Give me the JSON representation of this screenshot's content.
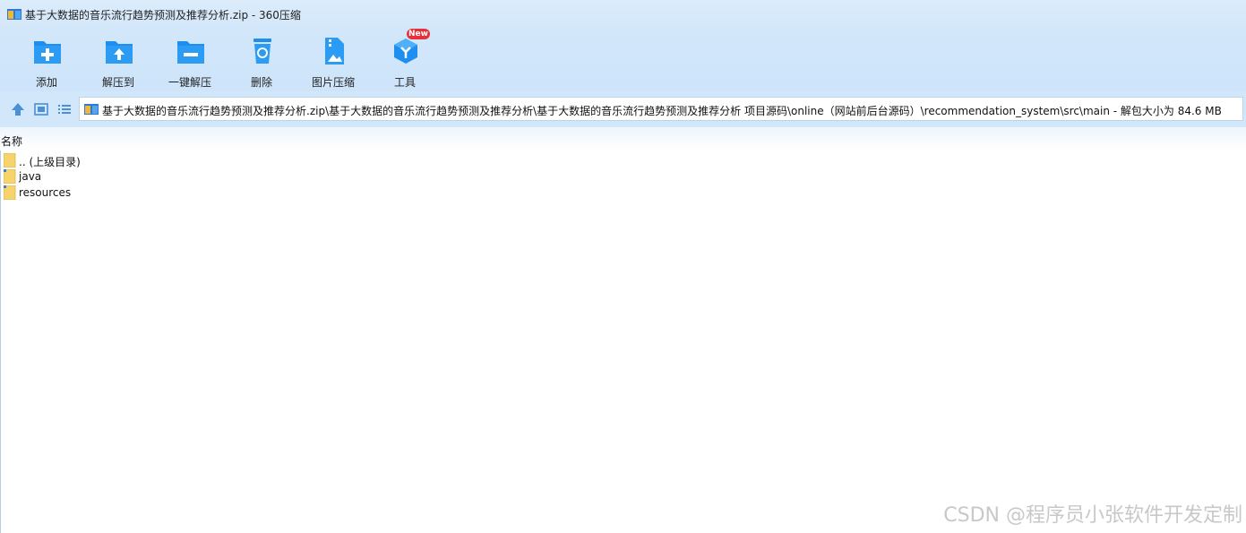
{
  "window": {
    "title": "基于大数据的音乐流行趋势预测及推荐分析.zip - 360压缩",
    "app_icon": "archive-icon"
  },
  "toolbar": {
    "items": [
      {
        "label": "添加",
        "icon": "add-folder-icon"
      },
      {
        "label": "解压到",
        "icon": "extract-to-folder-icon"
      },
      {
        "label": "一键解压",
        "icon": "one-click-extract-icon"
      },
      {
        "label": "删除",
        "icon": "recycle-bin-icon"
      },
      {
        "label": "图片压缩",
        "icon": "image-compress-icon"
      },
      {
        "label": "工具",
        "icon": "tools-cube-icon"
      }
    ],
    "new_badge": "New"
  },
  "address": {
    "path": "基于大数据的音乐流行趋势预测及推荐分析.zip\\基于大数据的音乐流行趋势预测及推荐分析\\基于大数据的音乐流行趋势预测及推荐分析 项目源码\\online（网站前后台源码）\\recommendation_system\\src\\main - 解包大小为 84.6 MB"
  },
  "list": {
    "column_name": "名称",
    "rows": [
      {
        "name": ".. (上级目录)",
        "icon": "folder-up-icon"
      },
      {
        "name": "java",
        "icon": "folder-icon"
      },
      {
        "name": "resources",
        "icon": "folder-icon"
      }
    ]
  },
  "watermark": "CSDN @程序员小张软件开发定制",
  "colors": {
    "accent": "#1e8ef0",
    "toolbar_bg": "#d3e7fa",
    "folder": "#f6d36b",
    "badge": "#e8303a"
  }
}
